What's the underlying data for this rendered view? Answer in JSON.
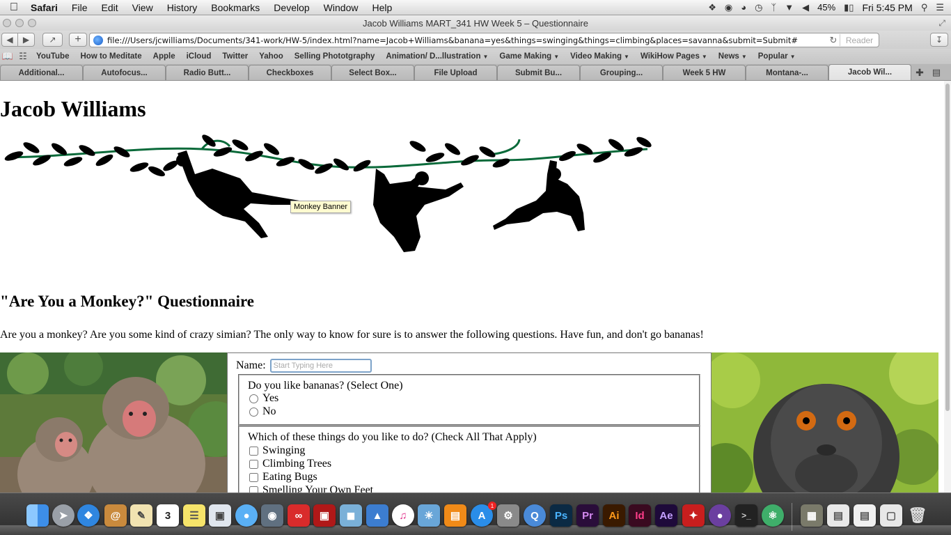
{
  "menubar": {
    "app_name": "Safari",
    "items": [
      "File",
      "Edit",
      "View",
      "History",
      "Bookmarks",
      "Develop",
      "Window",
      "Help"
    ],
    "battery": "45%",
    "clock": "Fri 5:45 PM"
  },
  "window": {
    "title": "Jacob Williams MART_341 HW Week 5 – Questionnaire"
  },
  "toolbar": {
    "url": "file:///Users/jcwilliams/Documents/341-work/HW-5/index.html?name=Jacob+Williams&banana=yes&things=swinging&things=climbing&places=savanna&submit=Submit#",
    "reader_label": "Reader"
  },
  "bookmarks": [
    {
      "label": "YouTube",
      "menu": false
    },
    {
      "label": "How to Meditate",
      "menu": false
    },
    {
      "label": "Apple",
      "menu": false
    },
    {
      "label": "iCloud",
      "menu": false
    },
    {
      "label": "Twitter",
      "menu": false
    },
    {
      "label": "Yahoo",
      "menu": false
    },
    {
      "label": "Selling Phototgraphy",
      "menu": false
    },
    {
      "label": "Animation/ D...llustration",
      "menu": true
    },
    {
      "label": "Game Making",
      "menu": true
    },
    {
      "label": "Video Making",
      "menu": true
    },
    {
      "label": "WikiHow Pages",
      "menu": true
    },
    {
      "label": "News",
      "menu": true
    },
    {
      "label": "Popular",
      "menu": true
    }
  ],
  "tabs": [
    "Additional...",
    "Autofocus...",
    "Radio Butt...",
    "Checkboxes",
    "Select Box...",
    "File Upload",
    "Submit Bu...",
    "Grouping...",
    "Week 5 HW",
    "Montana-...",
    "Jacob Wil..."
  ],
  "active_tab": 10,
  "page": {
    "title": "Jacob Williams",
    "banner_tooltip": "Monkey Banner",
    "section_heading": "\"Are You a Monkey?\" Questionnaire",
    "intro": "Are you a monkey? Are you some kind of crazy simian? The only way to know for sure is to answer the following questions. Have fun, and don't go bananas!",
    "form": {
      "name_label": "Name:",
      "name_placeholder": "Start Typing Here",
      "bananas_question": "Do you like bananas? (Select One)",
      "bananas_options": [
        "Yes",
        "No"
      ],
      "things_question": "Which of these things do you like to do? (Check All That Apply)",
      "things_options": [
        "Swinging",
        "Climbing Trees",
        "Eating Bugs",
        "Smelling Your Own Feet"
      ]
    }
  },
  "dock": {
    "calendar_day": "3",
    "app_store_badge": "1",
    "icons": [
      "finder-icon",
      "launchpad-icon",
      "safari-icon",
      "contacts-icon",
      "textedit-icon",
      "calendar-icon",
      "stickies-icon",
      "preview-icon",
      "messages-icon",
      "facetime-icon",
      "creative-cloud-icon",
      "photo-booth-icon",
      "iphoto-icon",
      "keynote-icon",
      "itunes-icon",
      "ibooks-icon",
      "app-store-icon",
      "system-preferences-icon",
      "quicktime-icon",
      "photoshop-icon",
      "premiere-icon",
      "illustrator-icon",
      "indesign-icon",
      "after-effects-icon",
      "acrobat-icon",
      "github-icon",
      "terminal-icon",
      "atom-icon"
    ],
    "ps_label": "Ps",
    "pr_label": "Pr",
    "ai_label": "Ai",
    "id_label": "Id",
    "ae_label": "Ae"
  }
}
